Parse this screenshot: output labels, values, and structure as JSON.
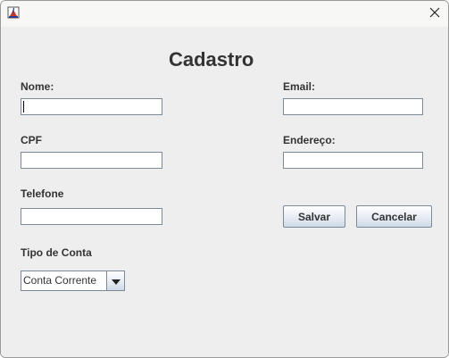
{
  "window": {
    "title": "",
    "close_icon": "close-icon",
    "app_icon": "java-icon"
  },
  "form": {
    "heading": "Cadastro",
    "nome_label": "Nome:",
    "nome_value": "",
    "email_label": "Email:",
    "email_value": "",
    "cpf_label": "CPF",
    "cpf_value": "",
    "endereco_label": "Endereço:",
    "endereco_value": "",
    "telefone_label": "Telefone",
    "telefone_value": "",
    "tipo_conta_label": "Tipo de Conta",
    "tipo_conta_selected": "Conta Corrente"
  },
  "buttons": {
    "save_label": "Salvar",
    "cancel_label": "Cancelar"
  },
  "colors": {
    "background": "#eeeeee",
    "field_border": "#7a8a99",
    "text": "#333333"
  }
}
